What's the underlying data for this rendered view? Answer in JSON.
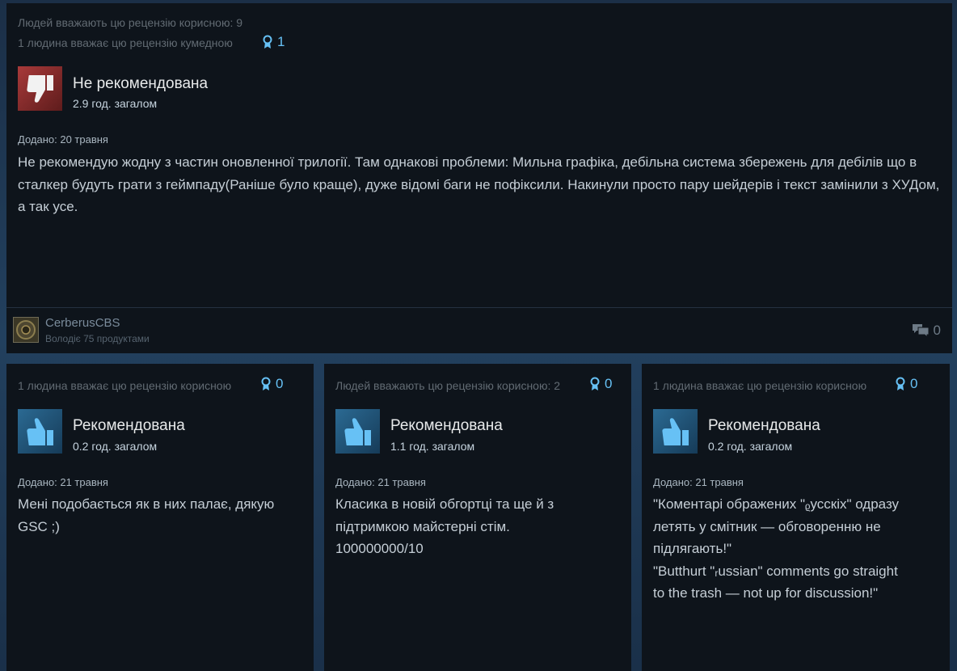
{
  "top_review": {
    "helpful_text": "Людей вважають цю рецензію корисною: 9",
    "funny_text": "1 людина вважає цю рецензію кумедною",
    "award_count": "1",
    "verdict": "Не рекомендована",
    "verdict_type": "not-recommended",
    "hours": "2.9 год. загалом",
    "posted": "Додано: 20 травня",
    "text": "Не рекомендую жодну з частин оновленної трилогії. Там однакові проблеми: Мильна графіка, дебільна система збережень для дебілів що в сталкер будуть грати з геймпаду(Раніше було краще), дуже відомі баги не пофіксили. Накинули просто пару шейдерів і текст замінили з ХУДом, а так усе.",
    "author": {
      "name": "CerberusCBS",
      "owns": "Володіє 75 продуктами"
    },
    "comment_count": "0"
  },
  "reviews": [
    {
      "helpful_text": "1 людина вважає цю рецензію корисною",
      "award_count": "0",
      "verdict": "Рекомендована",
      "verdict_type": "recommended",
      "hours": "0.2 год. загалом",
      "posted": "Додано: 21 травня",
      "lines": [
        "Мені подобається як в них палає, дякую",
        "GSC ;)"
      ]
    },
    {
      "helpful_text": "Людей вважають цю рецензію корисною: 2",
      "award_count": "0",
      "verdict": "Рекомендована",
      "verdict_type": "recommended",
      "hours": "1.1 год. загалом",
      "posted": "Додано: 21 травня",
      "lines": [
        "Класика в новій обгортці та ще й з",
        "підтримкою майстерні стім.",
        "100000000/10"
      ]
    },
    {
      "helpful_text": "1 людина вважає цю рецензію корисною",
      "award_count": "0",
      "verdict": "Рекомендована",
      "verdict_type": "recommended",
      "hours": "0.2 год. загалом",
      "posted": "Додано: 21 травня",
      "lines": [
        "\"Коментарі ображених \"ᵨусскіх\" одразу",
        "летять у смітник — обговоренню не",
        "підлягають!\"",
        "\"Butthurt \"ᵣussian\" comments go straight",
        "to the trash — not up for discussion!\""
      ]
    }
  ],
  "colors": {
    "card_bg": "#0e141b",
    "award_blue": "#66c0f4",
    "thumb_down": "#a83a3a",
    "thumb_up": "#2b6a93"
  },
  "icons": {
    "award": "award-ribbon-icon",
    "thumb_down": "thumbs-down-icon",
    "thumb_up": "thumbs-up-icon",
    "comment": "comment-bubbles-icon"
  }
}
